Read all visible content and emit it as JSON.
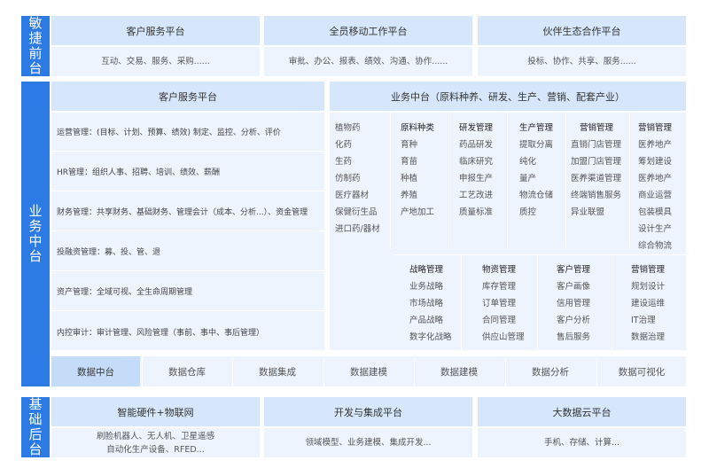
{
  "front": {
    "side_label": "敏\n捷\n前\n台",
    "platforms": [
      {
        "title": "客户服务平台",
        "desc": "互动、交易、服务、采购......"
      },
      {
        "title": "全员移动工作平台",
        "desc": "审批、办公、报表、绩效、沟通、协作......"
      },
      {
        "title": "伙伴生态合作平台",
        "desc": "投标、协作、共享、服务......"
      }
    ]
  },
  "business": {
    "side_label": "业\n务\n中\n台",
    "left_title": "客户服务平台",
    "left_items": [
      "运营管理：(目标、计划、预算、绩效) 制定、监控、分析、评价",
      "HR管理：组织人事、招聘、培训、绩效、薪酬",
      "财务管理：共享财务、基础财务、管理会计（成本、分析...）、资金管理",
      "投融资管理：募、投、管、退",
      "资产管理：全域可视、全生命周期管理",
      "内控审计：审计管理、风险管理（事前、事中、事后管理）"
    ],
    "right_title": "业务中台（原料种养、研发、生产、营销、配套产业）",
    "categories": [
      "植物药",
      "化药",
      "生药",
      "仿制药",
      "医疗器材",
      "保健衍生品",
      "进口药/器材"
    ],
    "top_columns": [
      {
        "title": "原料种类",
        "items": [
          "育种",
          "育苗",
          "种植",
          "养殖",
          "产地加工"
        ]
      },
      {
        "title": "研发管理",
        "items": [
          "药品研发",
          "临床研究",
          "申报生产",
          "工艺改进",
          "质量标准"
        ]
      },
      {
        "title": "生产管理",
        "items": [
          "提取分离",
          "纯化",
          "量产",
          "物流仓储",
          "质控"
        ]
      },
      {
        "title": "营销管理",
        "items": [
          "直销门店管理",
          "加盟门店管理",
          "医养渠道管理",
          "终端销售服务",
          "异业联盟"
        ]
      },
      {
        "title": "营销管理",
        "items": [
          "医养地产",
          "筹划建设",
          "医养地产",
          "商业运营",
          "包装模具",
          "设计生产",
          "综合物流"
        ]
      }
    ],
    "bottom_columns": [
      {
        "title": "战略管理",
        "items": [
          "业务战略",
          "市场战略",
          "产品战略",
          "数字化战略"
        ]
      },
      {
        "title": "物资管理",
        "items": [
          "库存管理",
          "订单管理",
          "合同管理",
          "供应山管理"
        ]
      },
      {
        "title": "客户管理",
        "items": [
          "客户画像",
          "信用管理",
          "客户分析",
          "售后服务"
        ]
      },
      {
        "title": "营销管理",
        "items": [
          "规划设计",
          "建设运维",
          "IT治理",
          "数据治理"
        ]
      }
    ],
    "data_bar": [
      "数据中台",
      "数据仓库",
      "数据集成",
      "数据建模",
      "数据建模",
      "数据分析",
      "数据可视化"
    ]
  },
  "base": {
    "side_label": "基\n础\n后\n台",
    "platforms": [
      {
        "title": "智能硬件+物联网",
        "desc": "刷脸机器人、无人机、卫星遥感\n自动化生产设备、RFED..."
      },
      {
        "title": "开发与集成平台",
        "desc": "领域模型、业务建模、集成开发..."
      },
      {
        "title": "大数据云平台",
        "desc": "手机、存储、计算..."
      }
    ]
  }
}
